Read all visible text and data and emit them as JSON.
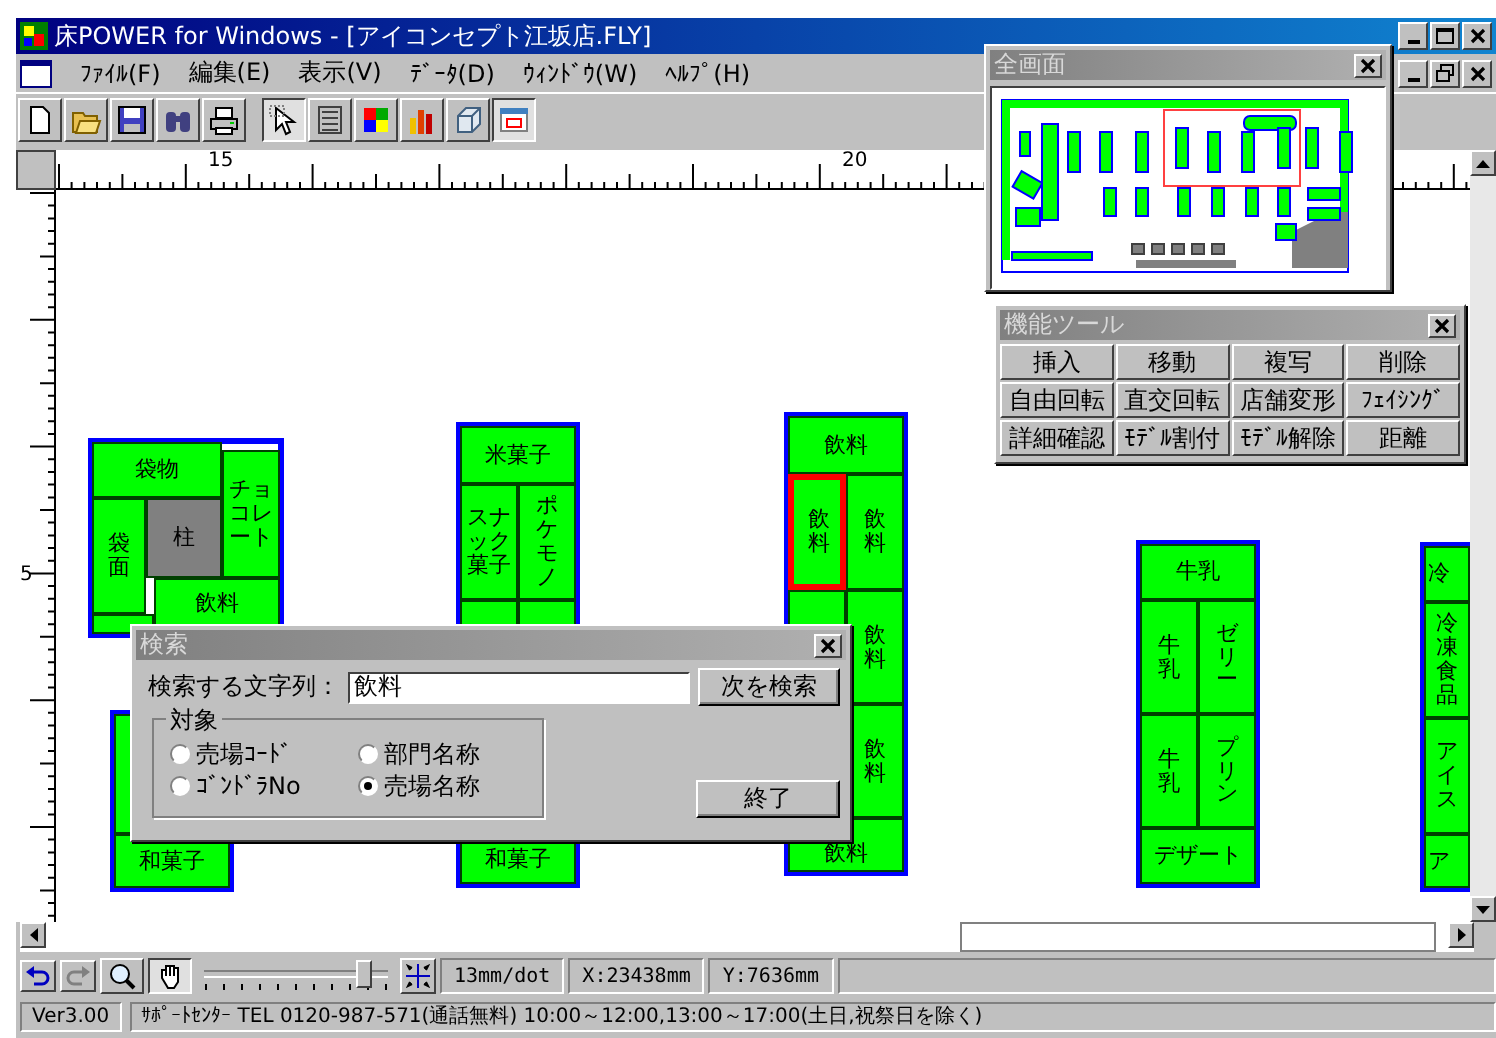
{
  "window": {
    "title": "床POWER for Windows - [アイコンセプト江坂店.FLY]"
  },
  "menu": [
    "ﾌｧｲﾙ(F)",
    "編集(E)",
    "表示(V)",
    "ﾃﾞｰﾀ(D)",
    "ｳｨﾝﾄﾞｳ(W)",
    "ﾍﾙﾌﾟ(H)"
  ],
  "toolbar": [
    {
      "kind": "new",
      "pressed": false
    },
    {
      "kind": "open",
      "pressed": false
    },
    {
      "kind": "save",
      "pressed": false
    },
    {
      "kind": "find",
      "pressed": false
    },
    {
      "kind": "print",
      "pressed": false
    },
    {
      "kind": "separator"
    },
    {
      "kind": "select",
      "pressed": true
    },
    {
      "kind": "list",
      "pressed": false
    },
    {
      "kind": "color",
      "pressed": false
    },
    {
      "kind": "chart",
      "pressed": false
    },
    {
      "kind": "box",
      "pressed": false
    },
    {
      "kind": "frame",
      "pressed": true
    }
  ],
  "ruler": {
    "top_labels": [
      "15",
      "20"
    ],
    "side_labels": [
      "5"
    ]
  },
  "fixtures": [
    {
      "kind": "shelf",
      "label": "袋物",
      "selected": false
    },
    {
      "kind": "shelf",
      "label": "チョコレート",
      "selected": false
    },
    {
      "kind": "shelf",
      "label": "袋面",
      "selected": false
    },
    {
      "kind": "pillar",
      "label": "柱",
      "selected": false
    },
    {
      "kind": "shelf",
      "label": "飲料",
      "selected": false
    },
    {
      "kind": "shelf",
      "selected": false
    },
    {
      "kind": "shelf",
      "selected": false
    },
    {
      "kind": "shelf",
      "label": "和菓子",
      "selected": false
    },
    {
      "kind": "shelf",
      "label": "米菓子",
      "selected": false
    },
    {
      "kind": "shelf",
      "label": "スナック菓子",
      "selected": false
    },
    {
      "kind": "shelf",
      "label": "ポケモノ",
      "selected": false
    },
    {
      "kind": "shelf",
      "selected": false
    },
    {
      "kind": "shelf",
      "selected": false
    },
    {
      "kind": "shelf",
      "label": "和菓子",
      "selected": false
    },
    {
      "kind": "shelf",
      "label": "飲料",
      "selected": false
    },
    {
      "kind": "shelf",
      "label": "飲料",
      "selected": true
    },
    {
      "kind": "shelf",
      "label": "飲料",
      "selected": false
    },
    {
      "kind": "shelf",
      "selected": false
    },
    {
      "kind": "shelf",
      "label": "飲料",
      "selected": false
    },
    {
      "kind": "shelf",
      "label": "飲料",
      "selected": false
    },
    {
      "kind": "shelf",
      "label": "飲料",
      "selected": false
    },
    {
      "kind": "shelf",
      "label": "牛乳",
      "selected": false
    },
    {
      "kind": "shelf",
      "label": "牛乳",
      "selected": false
    },
    {
      "kind": "shelf",
      "label": "ゼリー",
      "selected": false
    },
    {
      "kind": "shelf",
      "label": "牛乳",
      "selected": false
    },
    {
      "kind": "shelf",
      "label": "プリン",
      "selected": false
    },
    {
      "kind": "shelf",
      "label": "デザート",
      "selected": false
    },
    {
      "kind": "shelf",
      "label": "冷",
      "selected": false
    },
    {
      "kind": "shelf",
      "label": "冷凍食品",
      "selected": false
    },
    {
      "kind": "shelf",
      "label": "アイス",
      "selected": false
    },
    {
      "kind": "shelf",
      "label": "ア",
      "selected": false
    }
  ],
  "overview": {
    "title": "全画面"
  },
  "tools": {
    "title": "機能ツール",
    "buttons": [
      "挿入",
      "移動",
      "複写",
      "削除",
      "自由回転",
      "直交回転",
      "店舗変形",
      "ﾌｪｲｼﾝｸﾞ",
      "詳細確認",
      "ﾓﾃﾞﾙ割付",
      "ﾓﾃﾞﾙ解除",
      "距離"
    ]
  },
  "search": {
    "title": "検索",
    "label": "検索する文字列：",
    "value": "飲料",
    "next_button": "次を検索",
    "group": "対象",
    "options": [
      {
        "label": "売場ｺｰﾄﾞ",
        "selected": false
      },
      {
        "label": "部門名称",
        "selected": false
      },
      {
        "label": "ｺﾞﾝﾄﾞﾗNo",
        "selected": false
      },
      {
        "label": "売場名称",
        "selected": true
      }
    ],
    "end_button": "終了"
  },
  "bottom_toolbar": {
    "zoom": {
      "level": 0.86
    },
    "readouts": [
      "13mm/dot",
      "X:23438mm",
      "Y:7636mm"
    ]
  },
  "status_bar": [
    "Ver3.00",
    "ｻﾎﾟｰﾄｾﾝﾀｰ TEL 0120-987-571(通話無料) 10:00～12:00,13:00～17:00(土日,祝祭日を除く)"
  ]
}
